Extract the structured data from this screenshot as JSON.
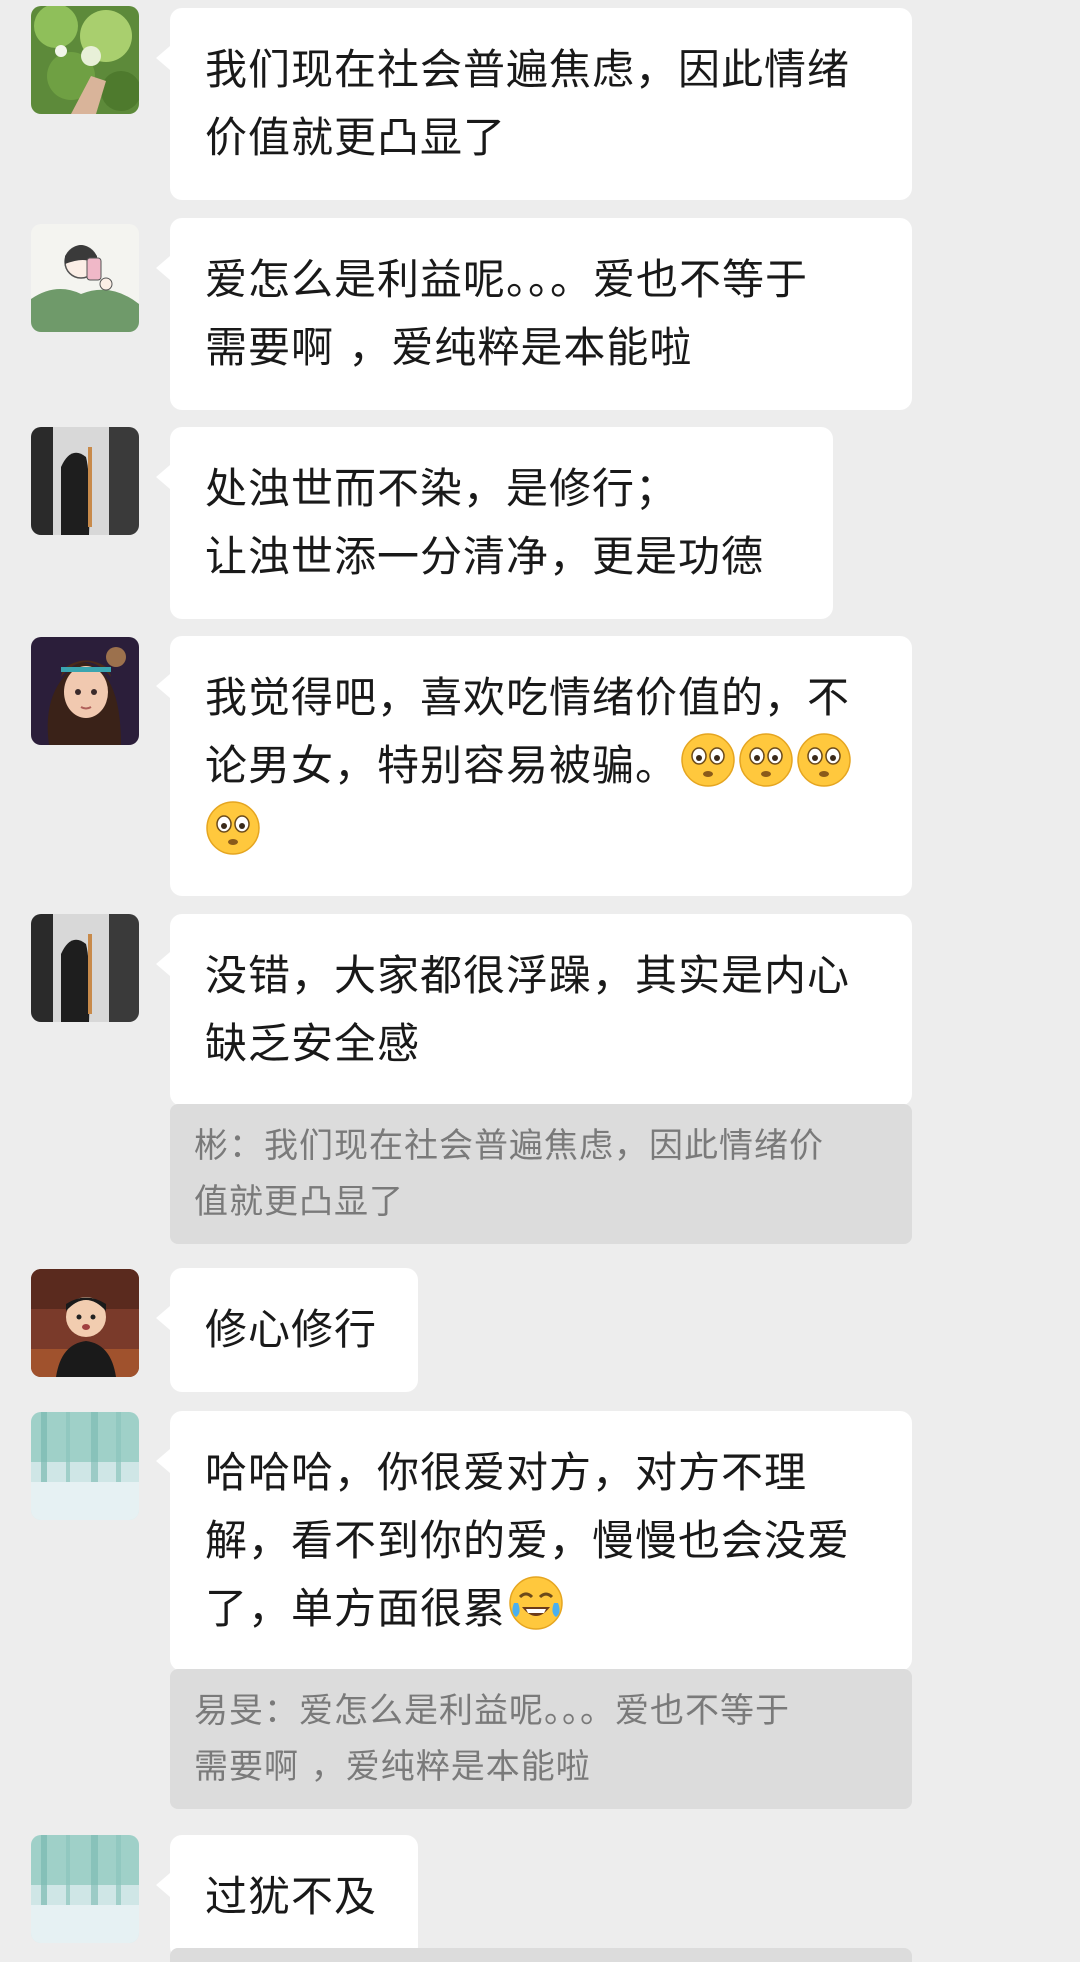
{
  "messages": [
    {
      "avatar": "avatar-green-leaves",
      "lines": [
        "我们现在社会普遍焦虑，因此情绪",
        "价值就更凸显了"
      ]
    },
    {
      "avatar": "avatar-sketch-girl-selfie",
      "lines": [
        "爱怎么是利益呢。。。爱也不等于",
        "需要啊 ，爱纯粹是本能啦"
      ]
    },
    {
      "avatar": "avatar-dark-silhouette",
      "lines": [
        "处浊世而不染，是修行；",
        "让浊世添一分清净，更是功德"
      ]
    },
    {
      "avatar": "avatar-anime-girl",
      "lines": [
        "我觉得吧，喜欢吃情绪价值的，不",
        "论男女，特别容易被骗。"
      ],
      "emoji": "flushed-face-emoji"
    },
    {
      "avatar": "avatar-dark-silhouette",
      "lines": [
        "没错，大家都很浮躁，其实是内心",
        "缺乏安全感"
      ],
      "quote": [
        "彬：我们现在社会普遍焦虑，因此情绪价",
        "值就更凸显了"
      ]
    },
    {
      "avatar": "avatar-child-photo",
      "lines": [
        "修心修行"
      ]
    },
    {
      "avatar": "avatar-blue-watercolor",
      "lines": [
        "哈哈哈，你很爱对方，对方不理",
        "解，看不到你的爱，慢慢也会没爱",
        "了，单方面很累"
      ],
      "emoji": "tears-of-joy-emoji",
      "quote": [
        "易旻：爱怎么是利益呢。。。爱也不等于",
        "需要啊 ，爱纯粹是本能啦"
      ]
    },
    {
      "avatar": "avatar-blue-watercolor",
      "lines": [
        "过犹不及"
      ]
    }
  ]
}
